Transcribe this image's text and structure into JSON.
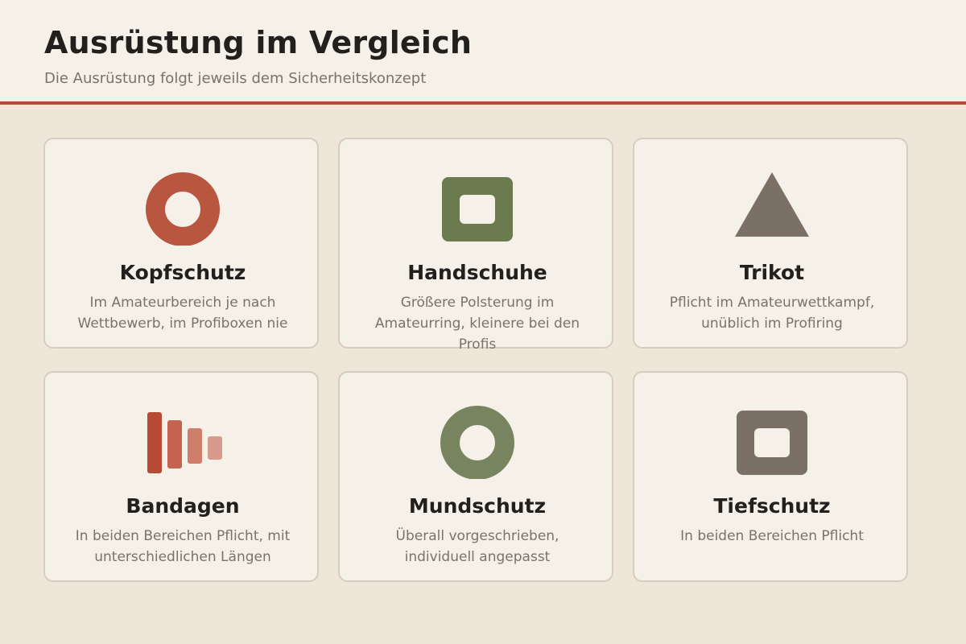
{
  "header": {
    "title": "Ausrüstung im Vergleich",
    "subtitle": "Die Ausrüstung folgt jeweils dem Sicherheitskonzept"
  },
  "cards": [
    {
      "title": "Kopfschutz",
      "description": "Im Amateurbereich je nach Wettbewerb, im Profiboxen nie",
      "icon": "ring-icon",
      "color": "#b95640"
    },
    {
      "title": "Handschuhe",
      "description": "Größere Polsterung im Amateurring, kleinere bei den Profis",
      "icon": "square-frame-icon",
      "color": "#6b7a4f"
    },
    {
      "title": "Trikot",
      "description": "Pflicht im Amateurwettkampf, unüblich im Profiring",
      "icon": "triangle-icon",
      "color": "#7a7065"
    },
    {
      "title": "Bandagen",
      "description": "In beiden Bereichen Pflicht, mit unterschiedlichen Längen",
      "icon": "bars-icon",
      "color": "#b84a35"
    },
    {
      "title": "Mundschutz",
      "description": "Überall vorgeschrieben, individuell angepasst",
      "icon": "ring-icon",
      "color": "#77845f"
    },
    {
      "title": "Tiefschutz",
      "description": "In beiden Bereichen Pflicht",
      "icon": "square-frame-icon",
      "color": "#7a7065"
    }
  ]
}
